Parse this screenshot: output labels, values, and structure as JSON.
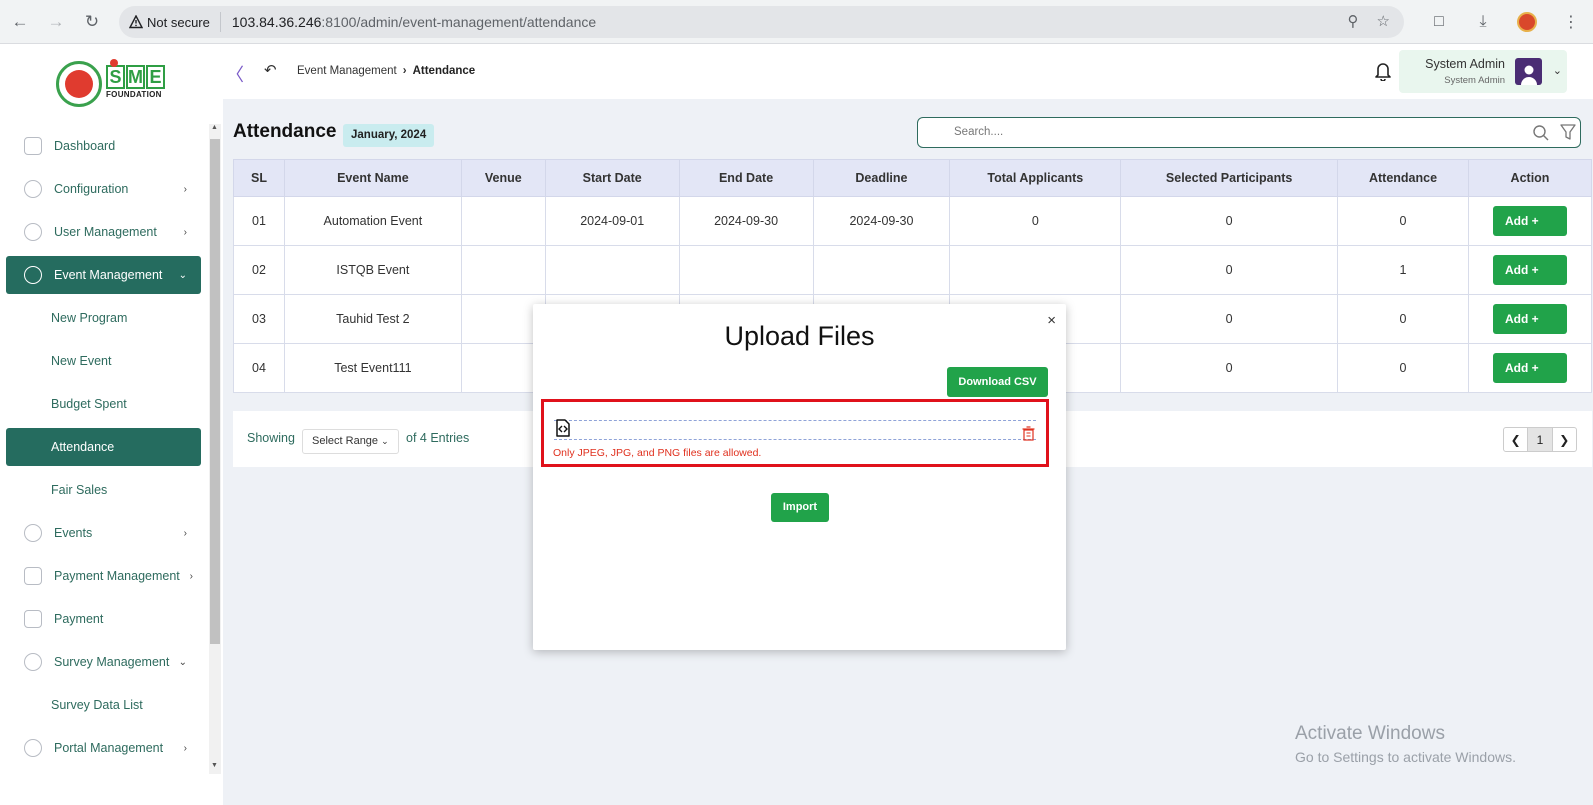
{
  "browser": {
    "security_label": "Not secure",
    "url_host": "103.84.36.246",
    "url_path": ":8100/admin/event-management/attendance"
  },
  "header": {
    "breadcrumb_parent": "Event Management",
    "breadcrumb_current": "Attendance",
    "user_name": "System Admin",
    "user_role": "System Admin"
  },
  "sidebar": {
    "items": [
      {
        "label": "Dashboard"
      },
      {
        "label": "Configuration"
      },
      {
        "label": "User Management"
      },
      {
        "label": "Event Management"
      },
      {
        "label": "New Program"
      },
      {
        "label": "New Event"
      },
      {
        "label": "Budget Spent"
      },
      {
        "label": "Attendance"
      },
      {
        "label": "Fair Sales"
      },
      {
        "label": "Events"
      },
      {
        "label": "Payment Management"
      },
      {
        "label": "Payment"
      },
      {
        "label": "Survey Management"
      },
      {
        "label": "Survey Data List"
      },
      {
        "label": "Portal Management"
      }
    ]
  },
  "main": {
    "title": "Attendance",
    "date_badge": "January, 2024",
    "search_placeholder": "Search....",
    "columns": [
      "SL",
      "Event Name",
      "Venue",
      "Start Date",
      "End Date",
      "Deadline",
      "Total Applicants",
      "Selected Participants",
      "Attendance",
      "Action"
    ],
    "rows": [
      {
        "sl": "01",
        "event_name": "Automation Event",
        "venue": "",
        "start_date": "2024-09-01",
        "end_date": "2024-09-30",
        "deadline": "2024-09-30",
        "total_applicants": "0",
        "selected_participants": "0",
        "attendance": "0",
        "action": "Add +"
      },
      {
        "sl": "02",
        "event_name": "ISTQB Event",
        "venue": "",
        "start_date": "",
        "end_date": "",
        "deadline": "",
        "total_applicants": "",
        "selected_participants": "0",
        "attendance": "1",
        "action": "Add +"
      },
      {
        "sl": "03",
        "event_name": "Tauhid Test 2",
        "venue": "",
        "start_date": "",
        "end_date": "",
        "deadline": "",
        "total_applicants": "",
        "selected_participants": "0",
        "attendance": "0",
        "action": "Add +"
      },
      {
        "sl": "04",
        "event_name": "Test Event111",
        "venue": "",
        "start_date": "",
        "end_date": "",
        "deadline": "",
        "total_applicants": "",
        "selected_participants": "0",
        "attendance": "0",
        "action": "Add +"
      }
    ],
    "footer": {
      "showing": "Showing",
      "range_select": "Select Range",
      "of_entries": "of 4 Entries",
      "current_page": "1"
    }
  },
  "modal": {
    "title": "Upload Files",
    "close": "×",
    "download_csv": "Download CSV",
    "error": "Only JPEG, JPG, and PNG files are allowed.",
    "import": "Import"
  },
  "watermark": {
    "line1": "Activate Windows",
    "line2": "Go to Settings to activate Windows."
  },
  "colors": {
    "primary_green": "#21a34a",
    "sidebar_active": "#256c5f",
    "error_red": "#e0111b",
    "table_header": "#e3e6f6"
  }
}
